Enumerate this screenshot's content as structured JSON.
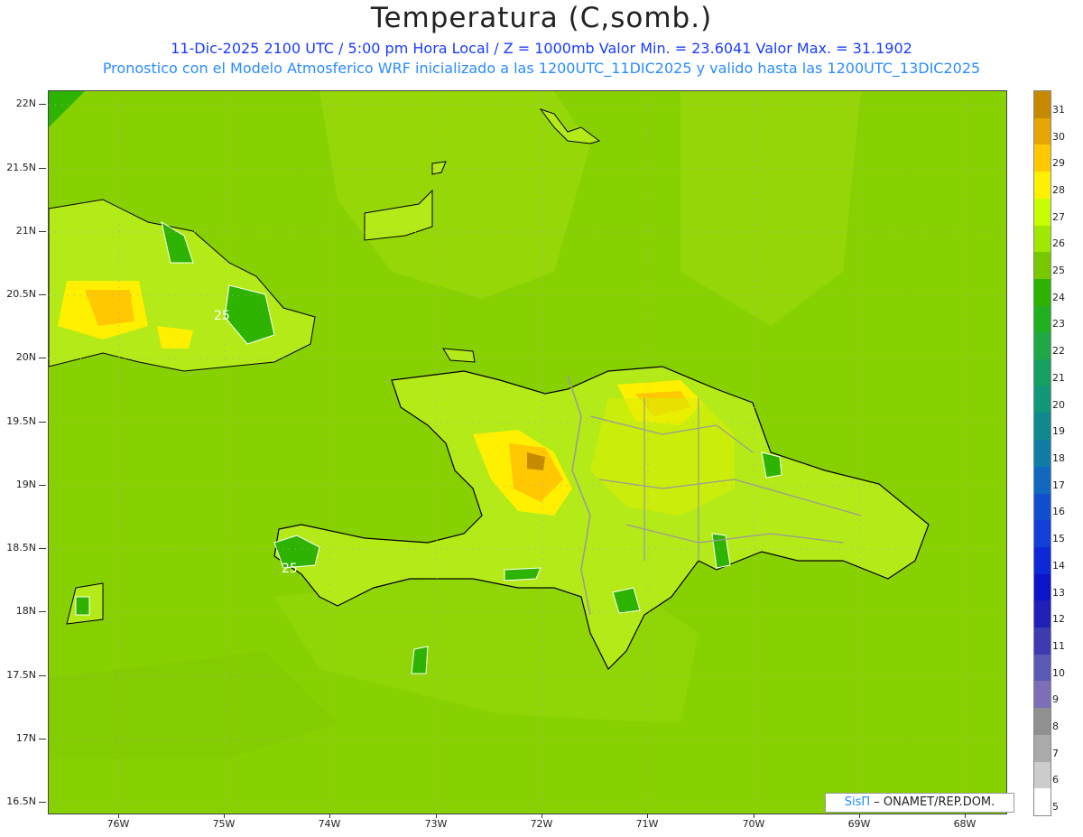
{
  "title": "Temperatura (C,somb.)",
  "subtitle_line1": "11-Dic-2025  2100 UTC / 5:00 pm Hora Local / Z = 1000mb   Valor Min. = 23.6041  Valor Max. = 31.1902",
  "subtitle_line2": "Pronostico con el Modelo Atmosferico WRF inicializado a las 1200UTC_11DIC2025 y valido hasta las  1200UTC_13DIC2025",
  "map": {
    "latitude_labels": [
      "22N",
      "21.5N",
      "21N",
      "20.5N",
      "20N",
      "19.5N",
      "19N",
      "18.5N",
      "18N",
      "17.5N",
      "17N",
      "16.5N"
    ],
    "longitude_labels": [
      "76W",
      "75W",
      "74W",
      "73W",
      "72W",
      "71W",
      "70W",
      "69W",
      "68W"
    ],
    "contour_labels": [
      "25",
      "25"
    ],
    "credit": {
      "brand": "SisΠ",
      "org": "– ONAMET/REP.DOM."
    }
  },
  "colorbar": {
    "labels": [
      "31",
      "30",
      "29",
      "28",
      "27",
      "26",
      "25",
      "24",
      "23",
      "22",
      "21",
      "20",
      "19",
      "18",
      "17",
      "16",
      "15",
      "14",
      "13",
      "12",
      "11",
      "10",
      "9",
      "8",
      "7",
      "6",
      "5"
    ],
    "colors": [
      "#c68a00",
      "#e8a400",
      "#ffc800",
      "#fff000",
      "#c8ff00",
      "#a0e800",
      "#78c800",
      "#2eb400",
      "#20b020",
      "#20a848",
      "#14a060",
      "#109878",
      "#108890",
      "#107ca8",
      "#1068c0",
      "#1050d0",
      "#1040d8",
      "#0c28d8",
      "#0c14c8",
      "#2020b8",
      "#3c3cb0",
      "#5a5ab4",
      "#7e6eb8",
      "#909090",
      "#aaaaaa",
      "#cccccc",
      "#ffffff"
    ]
  },
  "colors": {
    "sea": "#88d100",
    "land_warm": "#b4ea18",
    "coast": "#000000",
    "borders": "#999999"
  }
}
